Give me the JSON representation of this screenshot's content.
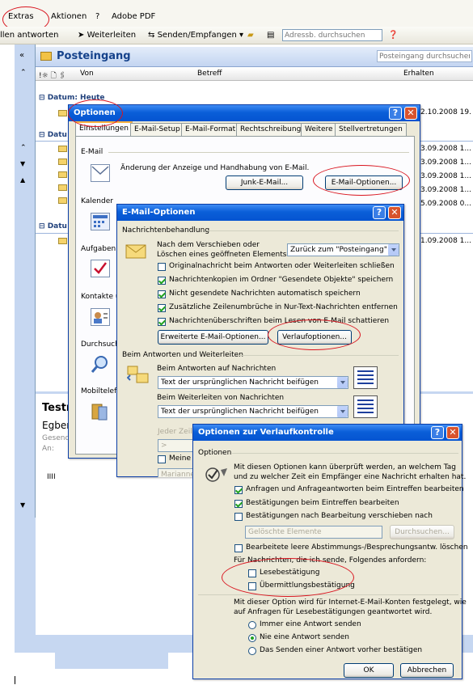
{
  "menu": {
    "extras": "Extras",
    "aktionen": "Aktionen",
    "help": "?",
    "adobe": "Adobe PDF"
  },
  "toolbar": {
    "allen": "llen antworten",
    "weiter": "Weiterleiten",
    "senden": "Senden/Empfangen",
    "adress_placeholder": "Adressb. durchsuchen"
  },
  "folder": {
    "title": "Posteingang",
    "search_placeholder": "Posteingang durchsuchen"
  },
  "columns": {
    "von": "Von",
    "betreff": "Betreff",
    "erhalten": "Erhalten"
  },
  "groups": {
    "heute": "Datum: Heute",
    "datum": "Datu"
  },
  "dates": [
    "2.10.2008 19.",
    "3.09.2008 1...",
    "3.09.2008 1...",
    "3.09.2008 1...",
    "3.09.2008 1...",
    "5.09.2008 0...",
    "1.09.2008 1..."
  ],
  "preview": {
    "title": "Testn",
    "from": "Egber",
    "gesend": "Gesend",
    "an": "An:",
    "body": "IIII"
  },
  "optionen": {
    "title": "Optionen",
    "tabs": [
      "Einstellungen",
      "E-Mail-Setup",
      "E-Mail-Format",
      "Rechtschreibung",
      "Weitere",
      "Stellvertretungen"
    ],
    "email_section": "E-Mail",
    "email_desc": "Änderung der Anzeige und Handhabung von E-Mail.",
    "junk_btn": "Junk-E-Mail...",
    "emailopt_btn": "E-Mail-Optionen...",
    "kalender": "Kalender",
    "aufgaben": "Aufgaben",
    "kontakte": "Kontakte u",
    "durchsuch": "Durchsuch",
    "mobil": "Mobiltelefo"
  },
  "emailopt": {
    "title": "E-Mail-Optionen",
    "section1": "Nachrichtenbehandlung",
    "move_label1": "Nach dem Verschieben oder",
    "move_label2": "Löschen eines geöffneten Elements:",
    "move_value": "Zurück zum \"Posteingang\"",
    "checks": [
      "Originalnachricht beim Antworten oder Weiterleiten schließen",
      "Nachrichtenkopien im Ordner \"Gesendete Objekte\" speichern",
      "Nicht gesendete Nachrichten automatisch speichern",
      "Zusätzliche Zeilenumbrüche in Nur-Text-Nachrichten entfernen",
      "Nachrichtenüberschriften beim Lesen von E-Mail schattieren"
    ],
    "adv_btn": "Erweiterte E-Mail-Optionen...",
    "verlauf_btn": "Verlaufoptionen...",
    "section2": "Beim Antworten und Weiterleiten",
    "reply_label": "Beim Antworten auf Nachrichten",
    "reply_value": "Text der ursprünglichen Nachricht beifügen",
    "fwd_label": "Beim Weiterleiten von Nachrichten",
    "fwd_value": "Text der ursprünglichen Nachricht beifügen",
    "jeder": "Jeder Zeile",
    "meine": "Meine K",
    "marianne": "Marianne"
  },
  "verlauf": {
    "title": "Optionen zur Verlaufkontrolle",
    "section": "Optionen",
    "desc1": "Mit diesen Optionen kann überprüft werden, an welchem Tag",
    "desc2": "und zu welcher Zeit ein Empfänger eine Nachricht erhalten hat.",
    "c1": "Anfragen und Anfrageantworten beim Eintreffen bearbeiten",
    "c2": "Bestätigungen beim Eintreffen bearbeiten",
    "c3": "Bestätigungen nach Bearbeitung verschieben nach",
    "folder_value": "Gelöschte Elemente",
    "browse_btn": "Durchsuchen...",
    "c4": "Bearbeitete leere Abstimmungs-/Besprechungsantw. löschen",
    "request_label": "Für Nachrichten, die ich sende, Folgendes anfordern:",
    "c5": "Lesebestätigung",
    "c6": "Übermittlungsbestätigung",
    "internet1": "Mit dieser Option wird für Internet-E-Mail-Konten festgelegt, wie",
    "internet2": "auf Anfragen für Lesebestätigungen geantwortet wird.",
    "r1": "Immer eine Antwort senden",
    "r2": "Nie eine Antwort senden",
    "r3": "Das Senden einer Antwort vorher bestätigen",
    "ok": "OK",
    "cancel": "Abbrechen"
  }
}
